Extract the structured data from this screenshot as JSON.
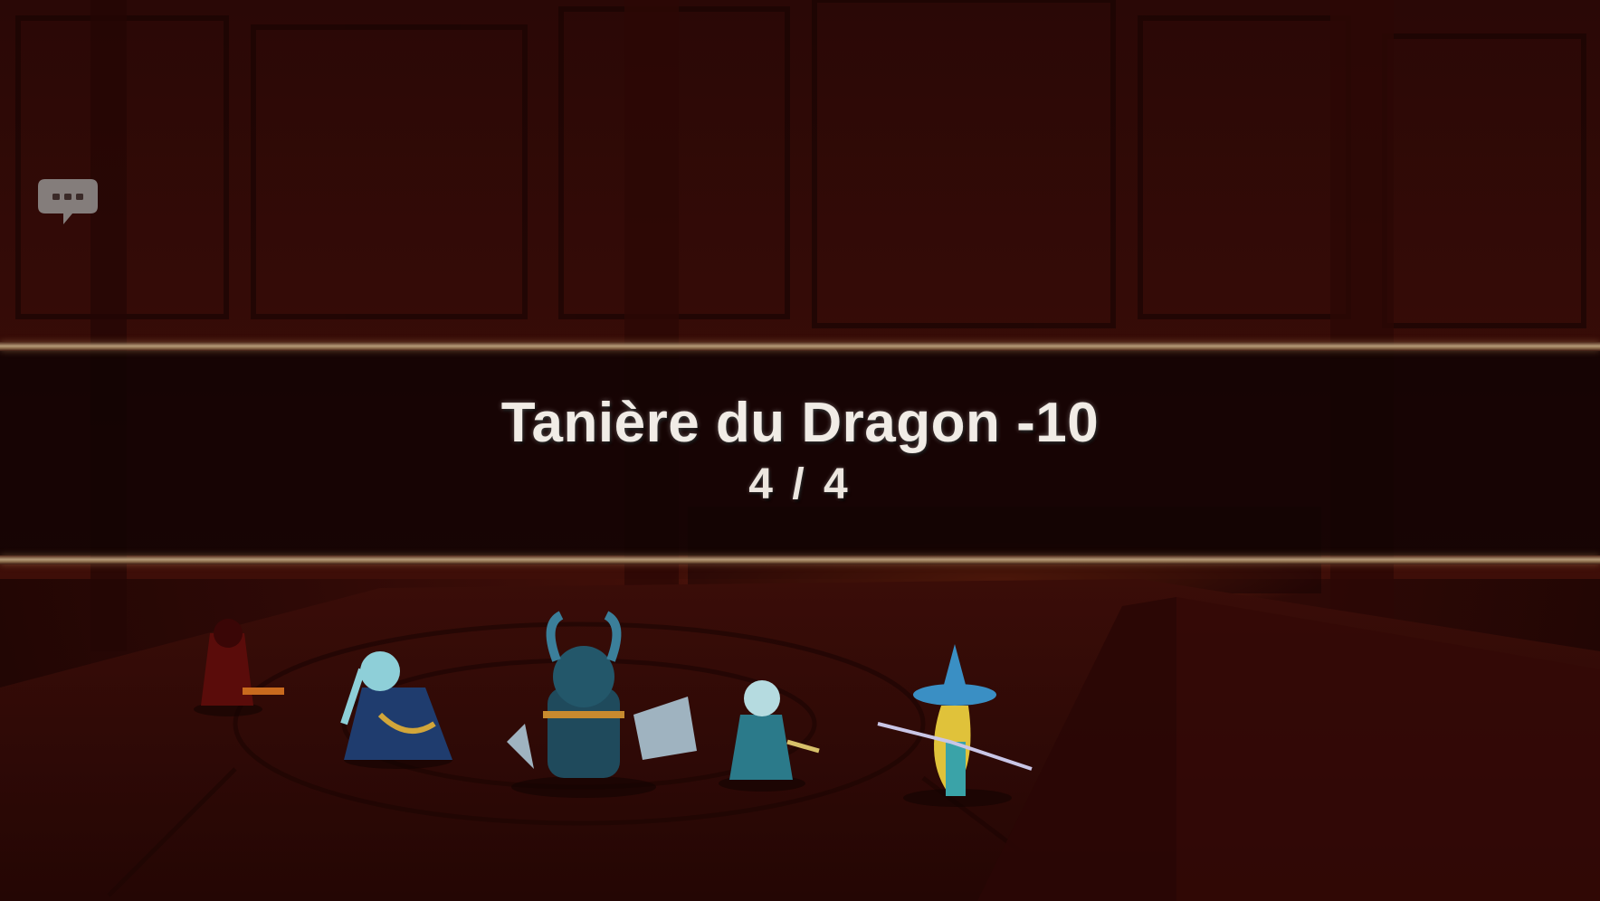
{
  "banner": {
    "stage_title": "Tanière du Dragon -10",
    "wave_counter": "4 / 4"
  },
  "hud": {
    "chat_icon": "chat-bubble-icon"
  },
  "colors": {
    "banner_background": "#120403",
    "banner_trim": "#b59a78",
    "title_text": "#f1ece6",
    "dungeon_red": "#4a120a"
  }
}
